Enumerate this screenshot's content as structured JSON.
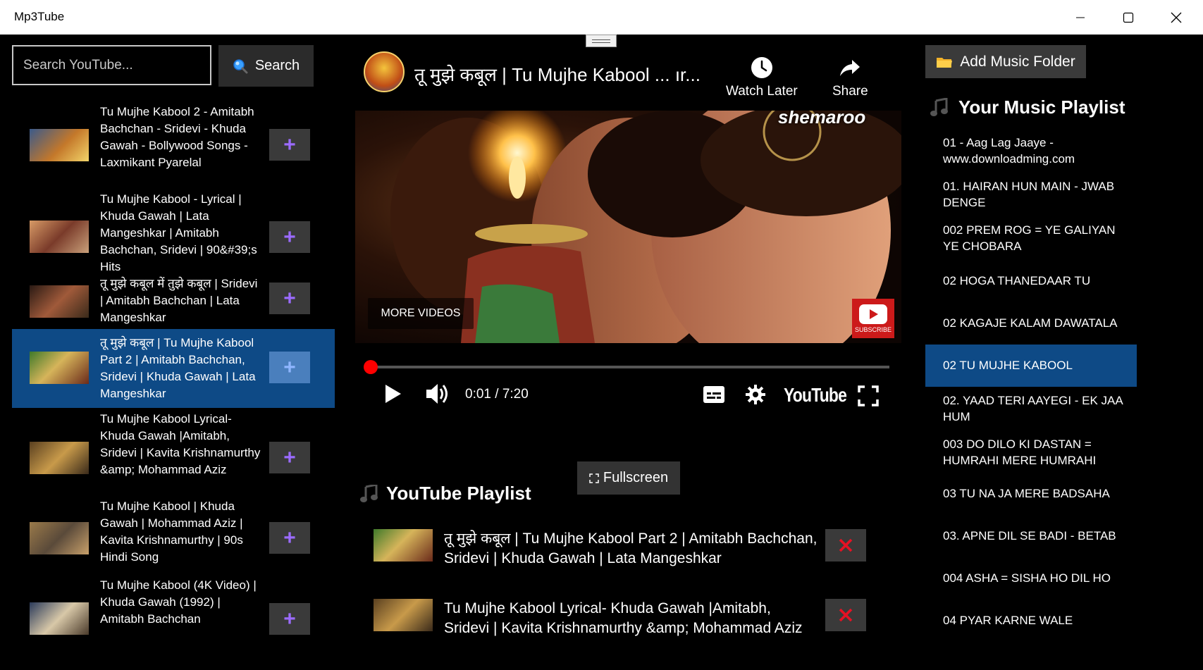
{
  "window": {
    "title": "Mp3Tube"
  },
  "search": {
    "placeholder": "Search YouTube...",
    "button_label": "Search"
  },
  "results": [
    {
      "title": "Tu Mujhe Kabool 2 - Amitabh Bachchan - Sridevi - Khuda Gawah - Bollywood Songs - Laxmikant Pyarelal",
      "thumb_color": "#5a3b2a"
    },
    {
      "title": "Tu Mujhe Kabool - Lyrical | Khuda Gawah | Lata Mangeshkar | Amitabh Bachchan, Sridevi | 90&#39;s Hits",
      "thumb_color": "#8a5a3a"
    },
    {
      "title": "तू मुझे कबूल में तुझे कबूल | Sridevi | Amitabh Bachchan | Lata Mangeshkar",
      "thumb_color": "#6a2a1a"
    },
    {
      "title": "तू मुझे कबूल | Tu Mujhe Kabool Part 2 | Amitabh Bachchan, Sridevi | Khuda Gawah | Lata Mangeshkar",
      "thumb_color": "#4a6a2a",
      "selected": true
    },
    {
      "title": "Tu Mujhe Kabool Lyrical- Khuda Gawah |Amitabh, Sridevi | Kavita Krishnamurthy &amp; Mohammad Aziz",
      "thumb_color": "#7a5a2a"
    },
    {
      "title": "Tu Mujhe Kabool | Khuda Gawah | Mohammad Aziz | Kavita Krishnamurthy | 90s Hindi Song",
      "thumb_color": "#8a6a4a"
    },
    {
      "title": "Tu Mujhe Kabool (4K Video) | Khuda Gawah (1992) | Amitabh Bachchan",
      "thumb_color": "#3a4a6a"
    }
  ],
  "player": {
    "title": "तू मुझे कबूल | Tu Mujhe Kabool ... ır...",
    "watch_later": "Watch Later",
    "share": "Share",
    "brand_watermark": "shemaroo",
    "more_videos": "MORE VIDEOS",
    "subscribe": "SUBSCRIBE",
    "time": "0:01 / 7:20",
    "youtube_label": "YouTube",
    "progress": 0.003,
    "fullscreen_label": "Fullscreen"
  },
  "youtube_playlist": {
    "heading": "YouTube Playlist",
    "items": [
      {
        "title": "तू मुझे कबूल | Tu Mujhe Kabool Part 2 | Amitabh Bachchan, Sridevi | Khuda Gawah | Lata Mangeshkar"
      },
      {
        "title": "Tu Mujhe Kabool Lyrical- Khuda Gawah |Amitabh, Sridevi | Kavita Krishnamurthy &amp; Mohammad Aziz"
      }
    ]
  },
  "music": {
    "add_folder_label": "Add Music Folder",
    "heading": "Your Music Playlist",
    "items": [
      "01 - Aag Lag Jaaye - www.downloadming.com",
      "01. HAIRAN HUN MAIN - JWAB DENGE",
      "002 PREM ROG = YE GALIYAN YE CHOBARA",
      "02 HOGA THANEDAAR TU",
      "02 KAGAJE KALAM DAWATALA",
      "02 TU MUJHE KABOOL",
      "02. YAAD TERI AAYEGI - EK JAA HUM",
      "003 DO DILO KI DASTAN = HUMRAHI MERE HUMRAHI",
      "03 TU NA JA MERE BADSAHA",
      "03. APNE DIL SE BADI - BETAB",
      "004 ASHA = SISHA HO DIL HO",
      "04 PYAR KARNE WALE"
    ],
    "selected_index": 5
  },
  "colors": {
    "accent": "#0e4a86",
    "progress": "#ff0000",
    "add_icon": "#9b6bff",
    "remove_icon": "#e81123"
  }
}
